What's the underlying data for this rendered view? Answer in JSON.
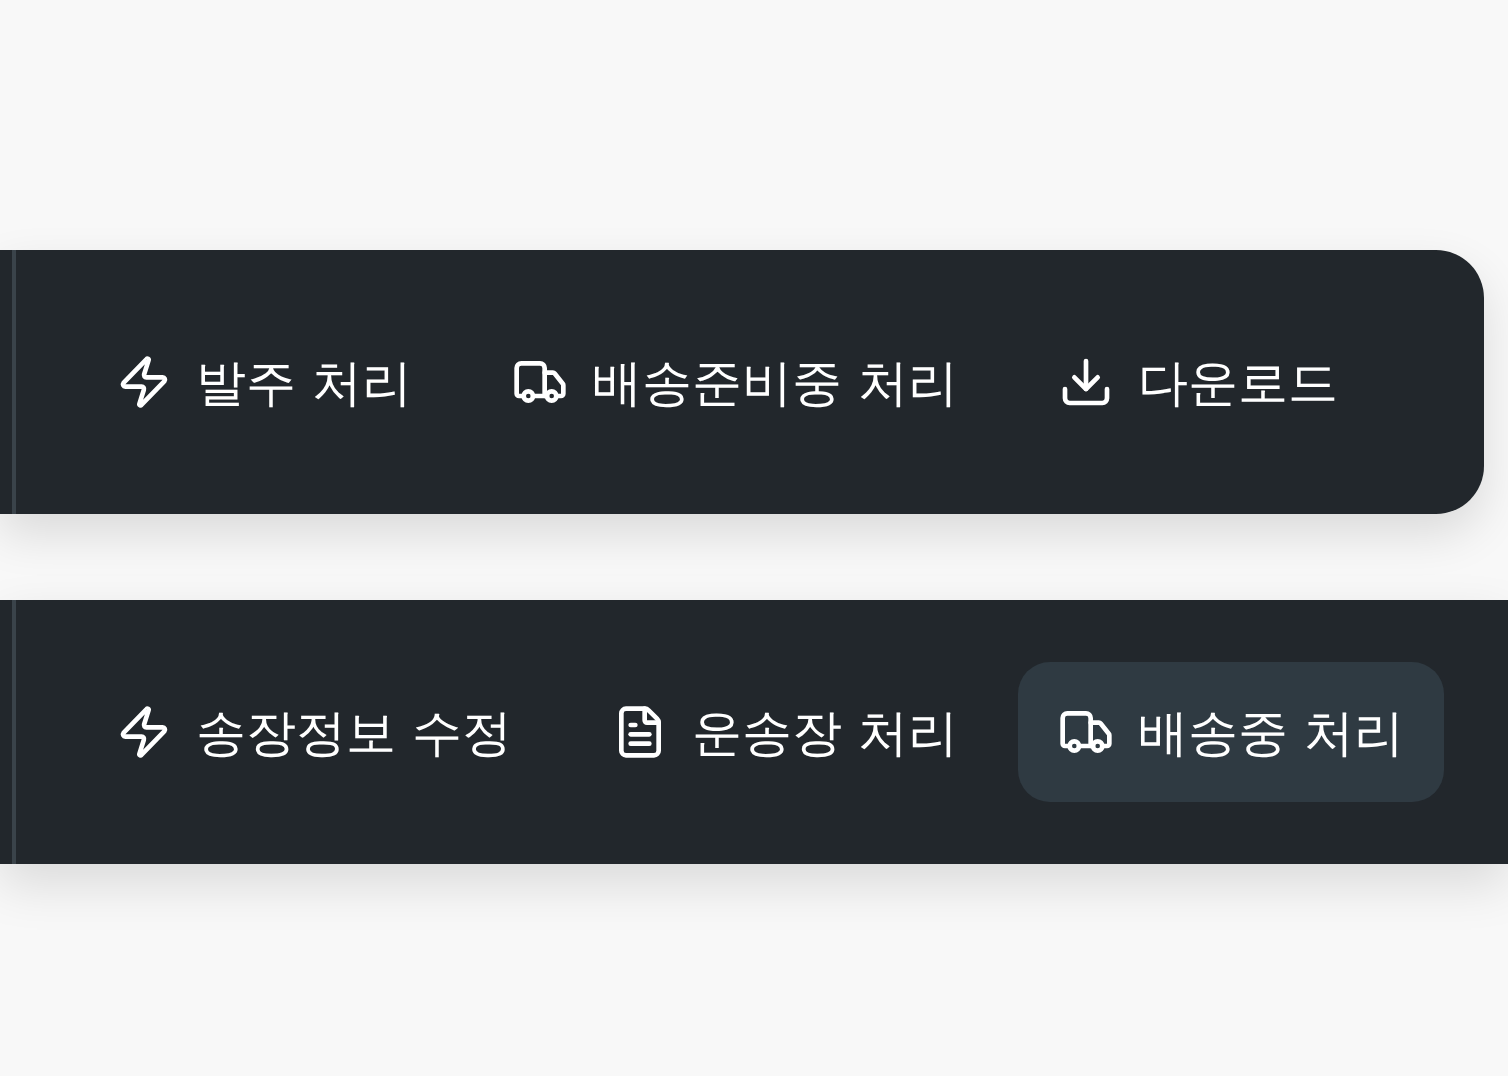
{
  "toolbars": [
    {
      "rounded": true,
      "buttons": [
        {
          "kind": "bolt",
          "label": "발주 처리",
          "selected": false
        },
        {
          "kind": "truck",
          "label": "배송준비중 처리",
          "selected": false
        },
        {
          "kind": "download",
          "label": "다운로드",
          "selected": false
        }
      ]
    },
    {
      "rounded": false,
      "buttons": [
        {
          "kind": "bolt",
          "label": "송장정보 수정",
          "selected": false
        },
        {
          "kind": "document",
          "label": "운송장 처리",
          "selected": false
        },
        {
          "kind": "truck",
          "label": "배송중 처리",
          "selected": true
        }
      ]
    }
  ]
}
